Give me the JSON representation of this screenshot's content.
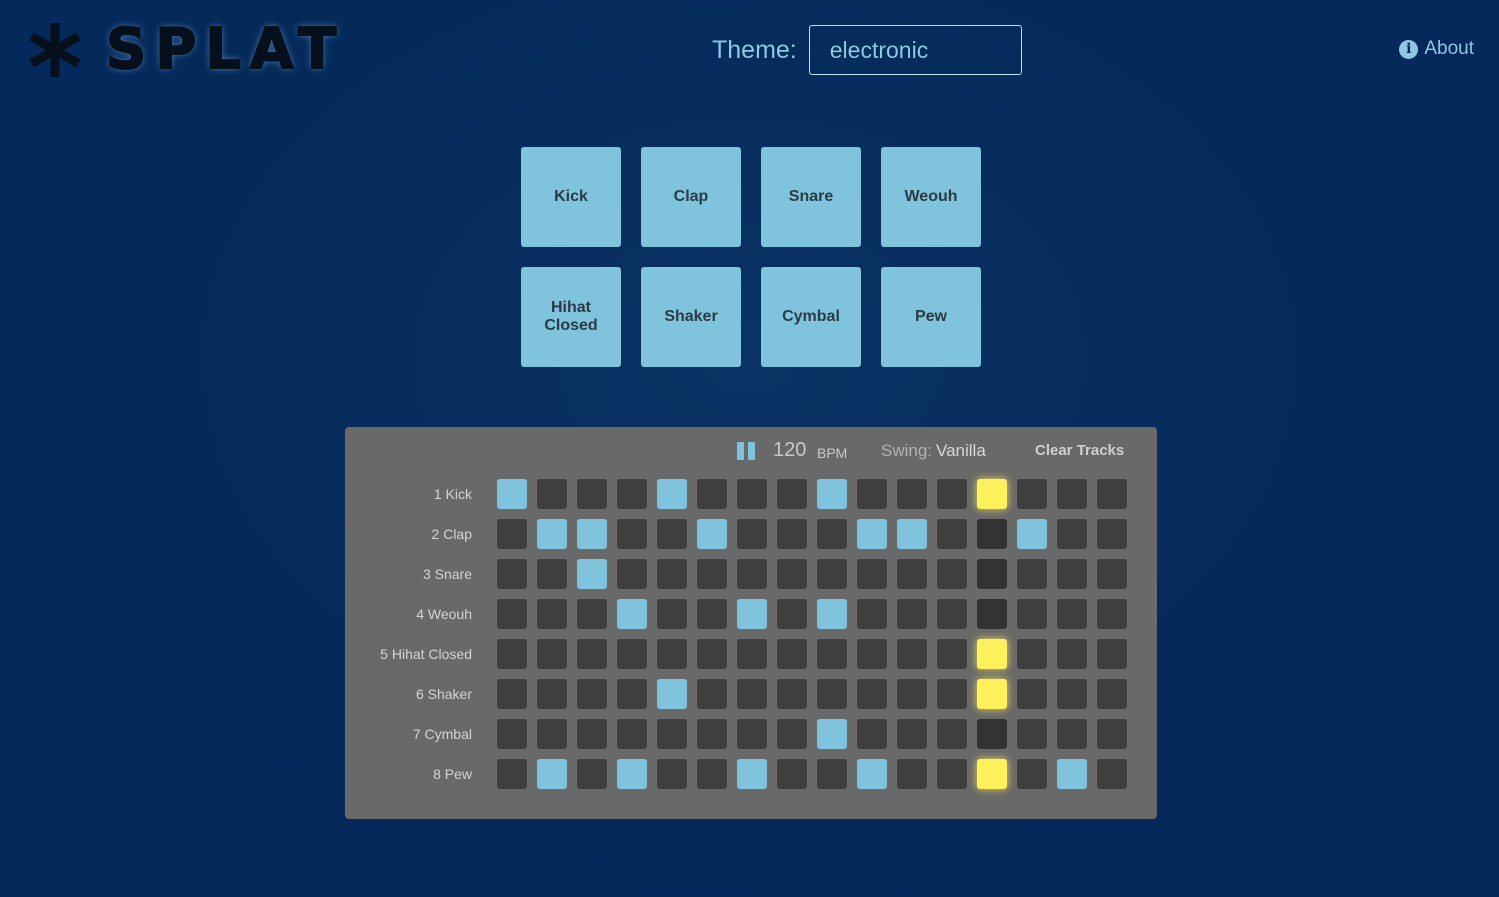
{
  "header": {
    "logo_text": "SPLAT",
    "theme_label": "Theme:",
    "theme_value": "electronic",
    "about_label": "About"
  },
  "icons": {
    "logo": "asterisk-icon",
    "about": "info-circle-icon",
    "play_state": "pause-icon"
  },
  "colors": {
    "background": "#04285a",
    "pad": "#7fc4dc",
    "step_on": "#7fc4dc",
    "step_off": "#3f3f3f",
    "step_playhead": "#fff15c",
    "panel": "#696969"
  },
  "pads": [
    {
      "label": "Kick"
    },
    {
      "label": "Clap"
    },
    {
      "label": "Snare"
    },
    {
      "label": "Weouh"
    },
    {
      "label": "Hihat Closed"
    },
    {
      "label": "Shaker"
    },
    {
      "label": "Cymbal"
    },
    {
      "label": "Pew"
    }
  ],
  "sequencer": {
    "bpm": "120",
    "bpm_unit": "BPM",
    "swing_label": "Swing:",
    "swing_value": "Vanilla",
    "clear_label": "Clear Tracks",
    "current_step": 13,
    "tracks": [
      {
        "label": "1 Kick",
        "steps": [
          1,
          0,
          0,
          0,
          1,
          0,
          0,
          0,
          1,
          0,
          0,
          0,
          1,
          0,
          0,
          0
        ]
      },
      {
        "label": "2 Clap",
        "steps": [
          0,
          1,
          1,
          0,
          0,
          1,
          0,
          0,
          0,
          1,
          1,
          0,
          0,
          1,
          0,
          0
        ]
      },
      {
        "label": "3 Snare",
        "steps": [
          0,
          0,
          1,
          0,
          0,
          0,
          0,
          0,
          0,
          0,
          0,
          0,
          0,
          0,
          0,
          0
        ]
      },
      {
        "label": "4 Weouh",
        "steps": [
          0,
          0,
          0,
          1,
          0,
          0,
          1,
          0,
          1,
          0,
          0,
          0,
          0,
          0,
          0,
          0
        ]
      },
      {
        "label": "5 Hihat Closed",
        "steps": [
          0,
          0,
          0,
          0,
          0,
          0,
          0,
          0,
          0,
          0,
          0,
          0,
          1,
          0,
          0,
          0
        ]
      },
      {
        "label": "6 Shaker",
        "steps": [
          0,
          0,
          0,
          0,
          1,
          0,
          0,
          0,
          0,
          0,
          0,
          0,
          1,
          0,
          0,
          0
        ]
      },
      {
        "label": "7 Cymbal",
        "steps": [
          0,
          0,
          0,
          0,
          0,
          0,
          0,
          0,
          1,
          0,
          0,
          0,
          0,
          0,
          0,
          0
        ]
      },
      {
        "label": "8 Pew",
        "steps": [
          0,
          1,
          0,
          1,
          0,
          0,
          1,
          0,
          0,
          1,
          0,
          0,
          1,
          0,
          1,
          0
        ]
      }
    ]
  }
}
